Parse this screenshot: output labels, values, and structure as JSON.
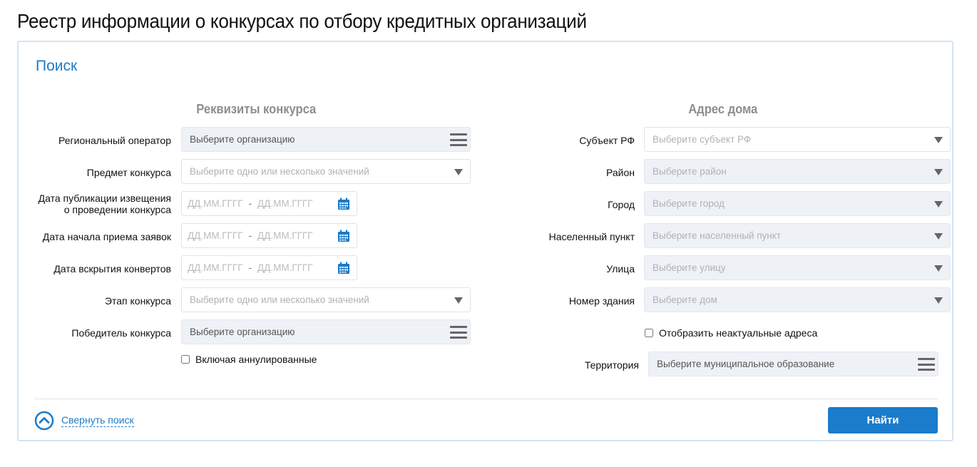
{
  "page": {
    "title": "Реестр информации о конкурсах по отбору кредитных организаций"
  },
  "search": {
    "title": "Поиск",
    "left_column": {
      "header": "Реквизиты конкурса",
      "regional_operator": {
        "label": "Региональный оператор",
        "placeholder": "Выберите организацию"
      },
      "subject": {
        "label": "Предмет конкурса",
        "placeholder": "Выберите одно или несколько значений"
      },
      "publication_date": {
        "label_line1": "Дата публикации извещения",
        "label_line2": "о проведении конкурса",
        "from": "ДД.ММ.ГГГГ",
        "sep": "-",
        "to": "ДД.ММ.ГГГГ"
      },
      "application_start": {
        "label": "Дата начала приема заявок",
        "from": "ДД.ММ.ГГГГ",
        "sep": "-",
        "to": "ДД.ММ.ГГГГ"
      },
      "envelope_opening": {
        "label": "Дата вскрытия конвертов",
        "from": "ДД.ММ.ГГГГ",
        "sep": "-",
        "to": "ДД.ММ.ГГГГ"
      },
      "stage": {
        "label": "Этап конкурса",
        "placeholder": "Выберите одно или несколько значений"
      },
      "winner": {
        "label": "Победитель конкурса",
        "placeholder": "Выберите организацию"
      },
      "include_annulled": {
        "label": "Включая аннулированные",
        "checked": false
      }
    },
    "right_column": {
      "header": "Адрес дома",
      "region": {
        "label": "Субъект РФ",
        "placeholder": "Выберите субъект РФ"
      },
      "district": {
        "label": "Район",
        "placeholder": "Выберите район"
      },
      "city": {
        "label": "Город",
        "placeholder": "Выберите город"
      },
      "settlement": {
        "label": "Населенный пункт",
        "placeholder": "Выберите населенный пункт"
      },
      "street": {
        "label": "Улица",
        "placeholder": "Выберите улицу"
      },
      "building": {
        "label": "Номер здания",
        "placeholder": "Выберите дом"
      },
      "show_outdated": {
        "label": "Отобразить неактуальные адреса",
        "checked": false
      },
      "territory": {
        "label": "Территория",
        "placeholder": "Выберите муниципальное образование"
      }
    },
    "collapse_label": "Свернуть поиск",
    "find_label": "Найти"
  },
  "icons": {
    "menu": "menu-icon",
    "caret": "chevron-down-icon",
    "calendar": "calendar-icon",
    "collapse": "chevron-up-circle-icon"
  },
  "colors": {
    "accent": "#1b7bc7",
    "button": "#1a7ccb",
    "panel_border": "#d4e5f3",
    "disabled_field": "#eef1f6"
  }
}
